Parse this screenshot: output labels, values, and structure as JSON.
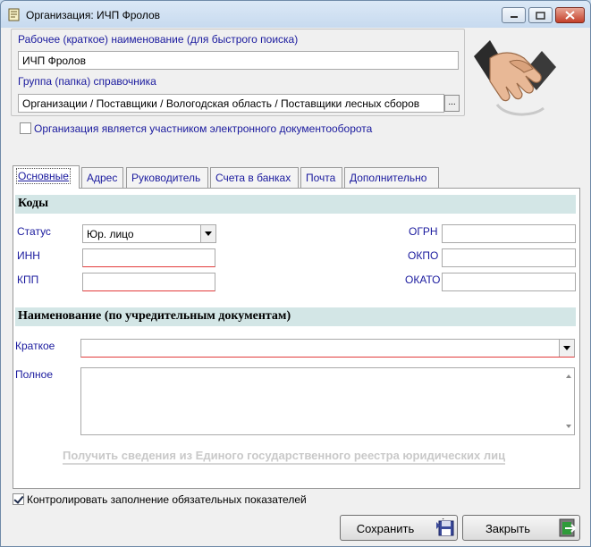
{
  "window": {
    "title": "Организация: ИЧП Фролов"
  },
  "top": {
    "work_name_label": "Рабочее (краткое) наименование (для быстрого поиска)",
    "work_name_value": "ИЧП Фролов",
    "group_label": "Группа (папка) справочника",
    "group_value": "Организации / Поставщики / Вологодская область / Поставщики лесных сборов",
    "group_button": "...",
    "edo_checkbox_label": "Организация является участником электронного документооборота",
    "edo_checked": false
  },
  "tabs": [
    {
      "label": "Основные"
    },
    {
      "label": "Адрес"
    },
    {
      "label": "Руководитель"
    },
    {
      "label": "Счета в банках"
    },
    {
      "label": "Почта"
    },
    {
      "label": "Дополнительно"
    }
  ],
  "codes": {
    "section_title": "Коды",
    "status_label": "Статус",
    "status_value": "Юр. лицо",
    "inn_label": "ИНН",
    "inn_value": "",
    "kpp_label": "КПП",
    "kpp_value": "",
    "ogrn_label": "ОГРН",
    "ogrn_value": "",
    "okpo_label": "ОКПО",
    "okpo_value": "",
    "okato_label": "ОКАТО",
    "okato_value": ""
  },
  "naming": {
    "section_title": "Наименование (по учредительным документам)",
    "short_label": "Краткое",
    "short_value": "",
    "full_label": "Полное",
    "full_value": "",
    "egrul_link": "Получить сведения из Единого государственного реестра юридических лиц"
  },
  "footer": {
    "control_checkbox_label": "Контролировать заполнение обязательных показателей",
    "control_checked": true,
    "save_label": "Сохранить",
    "close_label": "Закрыть"
  },
  "colors": {
    "label_blue": "#1a1a9e",
    "section_bg": "#d3e6e6",
    "required_underline": "#e23b3b"
  },
  "icons": [
    "form-icon",
    "minimize-icon",
    "maximize-icon",
    "close-icon",
    "handshake-icon",
    "save-disk-icon",
    "exit-door-icon"
  ]
}
